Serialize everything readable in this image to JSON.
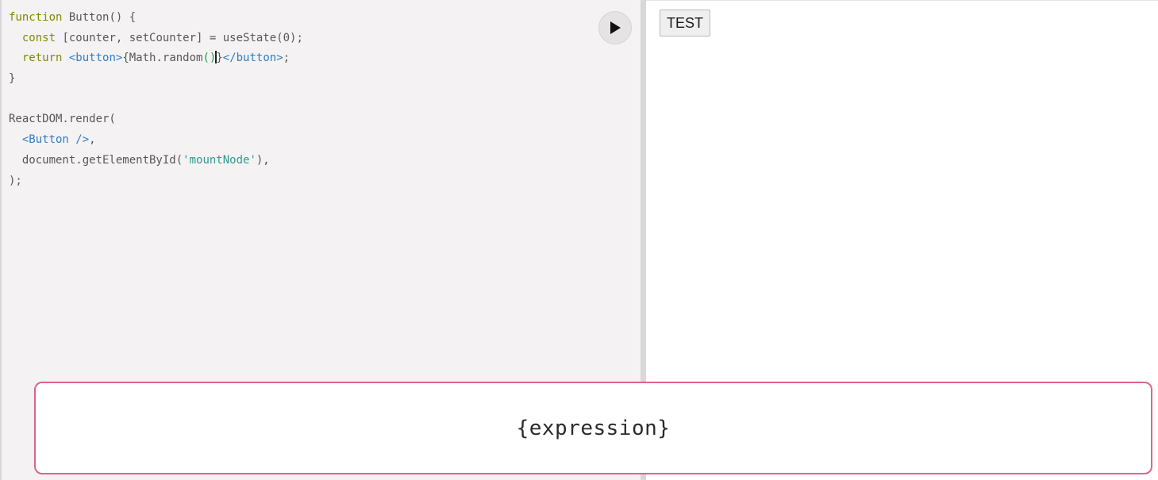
{
  "editor": {
    "lines": [
      {
        "parts": [
          {
            "text": "function",
            "kind": "kw"
          },
          {
            "text": " Button() {",
            "kind": "plain"
          }
        ]
      },
      {
        "parts": [
          {
            "text": "  ",
            "kind": "plain"
          },
          {
            "text": "const",
            "kind": "kw"
          },
          {
            "text": " [counter, setCounter] = useState(0);",
            "kind": "plain"
          }
        ]
      },
      {
        "parts": [
          {
            "text": "  ",
            "kind": "plain"
          },
          {
            "text": "return",
            "kind": "kw"
          },
          {
            "text": " ",
            "kind": "plain"
          },
          {
            "text": "<button>",
            "kind": "tag"
          },
          {
            "text": "{Math.random",
            "kind": "plain"
          },
          {
            "text": "()",
            "kind": "paren-hl"
          },
          {
            "text": "",
            "kind": "cursor"
          },
          {
            "text": "}",
            "kind": "plain"
          },
          {
            "text": "</button>",
            "kind": "tag"
          },
          {
            "text": ";",
            "kind": "plain"
          }
        ]
      },
      {
        "parts": [
          {
            "text": "}",
            "kind": "plain"
          }
        ]
      },
      {
        "parts": [
          {
            "text": "",
            "kind": "plain"
          }
        ]
      },
      {
        "parts": [
          {
            "text": "ReactDOM.render(",
            "kind": "plain"
          }
        ]
      },
      {
        "parts": [
          {
            "text": "  ",
            "kind": "plain"
          },
          {
            "text": "<Button />",
            "kind": "tag"
          },
          {
            "text": ",",
            "kind": "plain"
          }
        ]
      },
      {
        "parts": [
          {
            "text": "  document.getElementById(",
            "kind": "plain"
          },
          {
            "text": "'mountNode'",
            "kind": "str"
          },
          {
            "text": "),",
            "kind": "plain"
          }
        ]
      },
      {
        "parts": [
          {
            "text": ");",
            "kind": "plain"
          }
        ]
      }
    ]
  },
  "run_button": {
    "icon": "play-icon"
  },
  "preview": {
    "button_label": "TEST"
  },
  "caption": {
    "text": "{expression}",
    "border_color": "#d9668a"
  }
}
